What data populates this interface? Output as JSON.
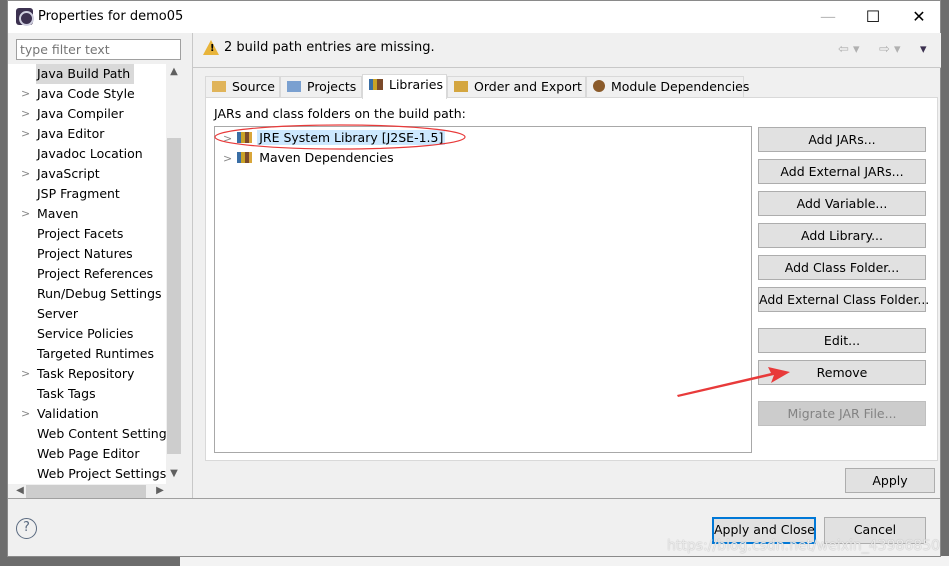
{
  "window": {
    "title": "Properties for demo05",
    "minimize": "—",
    "maximize": "☐",
    "close": "✕"
  },
  "filter": {
    "placeholder": "type filter text"
  },
  "tree": {
    "selected": "Java Build Path",
    "items": [
      {
        "label": "Java Build Path",
        "expandable": false
      },
      {
        "label": "Java Code Style",
        "expandable": true
      },
      {
        "label": "Java Compiler",
        "expandable": true
      },
      {
        "label": "Java Editor",
        "expandable": true
      },
      {
        "label": "Javadoc Location",
        "expandable": false
      },
      {
        "label": "JavaScript",
        "expandable": true
      },
      {
        "label": "JSP Fragment",
        "expandable": false
      },
      {
        "label": "Maven",
        "expandable": true
      },
      {
        "label": "Project Facets",
        "expandable": false
      },
      {
        "label": "Project Natures",
        "expandable": false
      },
      {
        "label": "Project References",
        "expandable": false
      },
      {
        "label": "Run/Debug Settings",
        "expandable": false
      },
      {
        "label": "Server",
        "expandable": false
      },
      {
        "label": "Service Policies",
        "expandable": false
      },
      {
        "label": "Targeted Runtimes",
        "expandable": false
      },
      {
        "label": "Task Repository",
        "expandable": true
      },
      {
        "label": "Task Tags",
        "expandable": false
      },
      {
        "label": "Validation",
        "expandable": true
      },
      {
        "label": "Web Content Settings",
        "expandable": false
      },
      {
        "label": "Web Page Editor",
        "expandable": false
      },
      {
        "label": "Web Project Settings",
        "expandable": false
      }
    ]
  },
  "header": {
    "message": "2 build path entries are missing.",
    "icon": "warning-icon"
  },
  "tabs": [
    {
      "label": "Source",
      "icon": "source-folder-icon",
      "active": false
    },
    {
      "label": "Projects",
      "icon": "projects-folder-icon",
      "active": false
    },
    {
      "label": "Libraries",
      "icon": "library-icon",
      "active": true
    },
    {
      "label": "Order and Export",
      "icon": "order-export-icon",
      "active": false
    },
    {
      "label": "Module Dependencies",
      "icon": "maven-module-icon",
      "active": false
    }
  ],
  "libraries": {
    "label": "JARs and class folders on the build path:",
    "entries": [
      {
        "label": "JRE System Library [J2SE-1.5]",
        "selected": true
      },
      {
        "label": "Maven Dependencies",
        "selected": false
      }
    ],
    "buttons": [
      {
        "label": "Add JARs...",
        "enabled": true
      },
      {
        "label": "Add External JARs...",
        "enabled": true
      },
      {
        "label": "Add Variable...",
        "enabled": true
      },
      {
        "label": "Add Library...",
        "enabled": true
      },
      {
        "label": "Add Class Folder...",
        "enabled": true
      },
      {
        "label": "Add External Class Folder...",
        "enabled": true
      },
      {
        "label": "Edit...",
        "enabled": true
      },
      {
        "label": "Remove",
        "enabled": true
      },
      {
        "label": "Migrate JAR File...",
        "enabled": false
      }
    ]
  },
  "footer": {
    "apply": "Apply",
    "apply_close": "Apply and Close",
    "cancel": "Cancel",
    "help": "?"
  },
  "watermark": "https://blog.csdn.net/weixin_43986850",
  "colors": {
    "annotation": "#e83a3a",
    "selection": "#cce8ff",
    "default_button_border": "#0078d7"
  }
}
